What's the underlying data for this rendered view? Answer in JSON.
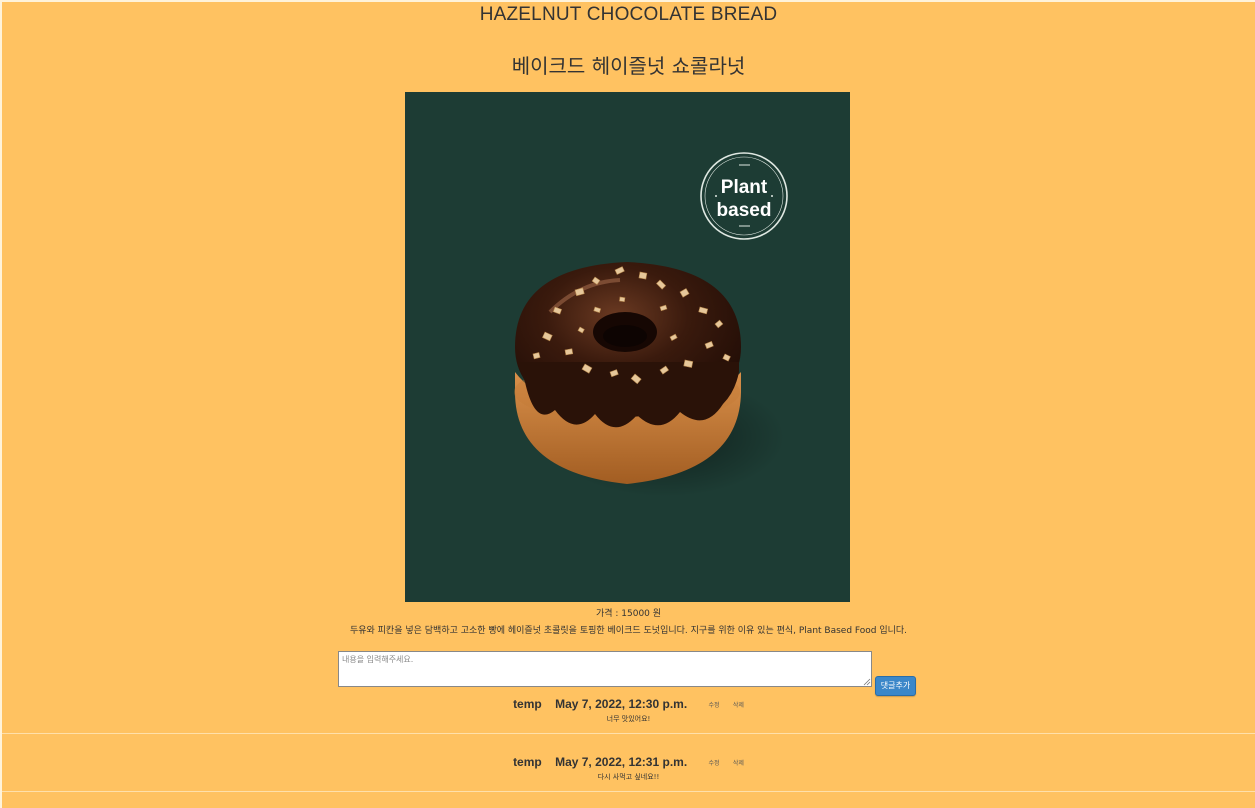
{
  "product": {
    "name_en": "HAZELNUT CHOCOLATE BREAD",
    "name_ko": "베이크드 헤이즐넛 쇼콜라넛",
    "badge_line1": "Plant",
    "badge_line2": "based",
    "price_text": "가격 : 15000 원",
    "description": "두유와 피칸을 넣은 담백하고 고소한 빵에 헤이즐넛 초콜릿을 토핑한 베이크드 도넛입니다. 지구를 위한 이유 있는 편식, Plant Based Food 입니다."
  },
  "comment_form": {
    "placeholder": "내용을 입력해주세요.",
    "submit_label": "댓글추가"
  },
  "comments": [
    {
      "author": "temp",
      "date": "May 7, 2022, 12:30 p.m.",
      "edit_label": "수정",
      "delete_label": "삭제",
      "body": "너무 맛있어요!"
    },
    {
      "author": "temp",
      "date": "May 7, 2022, 12:31 p.m.",
      "edit_label": "수정",
      "delete_label": "삭제",
      "body": "다시 사먹고 싶네요!!"
    }
  ],
  "colors": {
    "page_background": "#ffc261",
    "image_background": "#1d3c34",
    "button": "#3b87c9"
  }
}
